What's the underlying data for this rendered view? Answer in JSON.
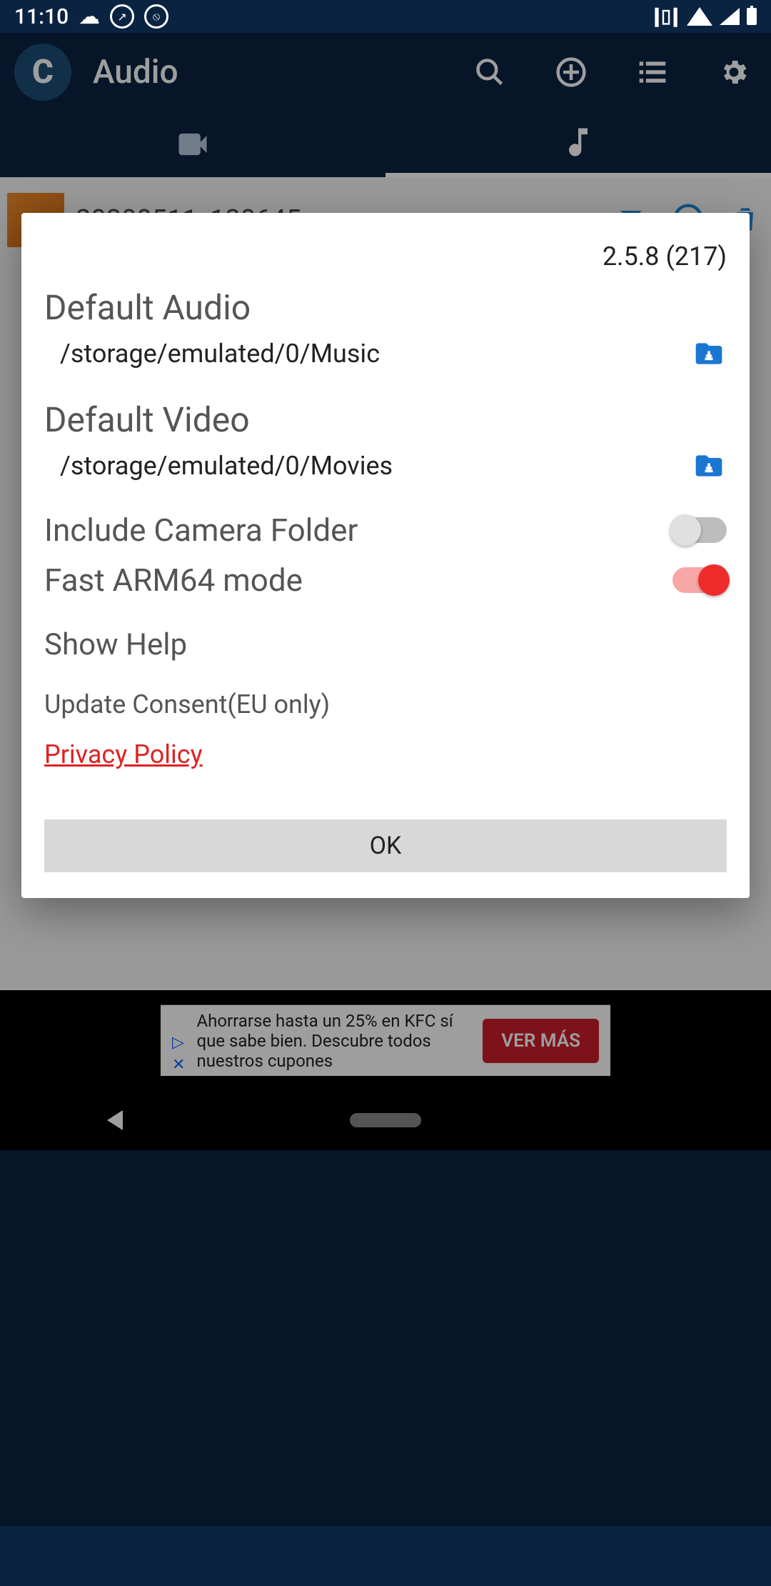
{
  "status": {
    "time": "11:10"
  },
  "appbar": {
    "title": "Audio"
  },
  "list": {
    "items": [
      {
        "name": "20200511_120645"
      }
    ]
  },
  "ad": {
    "text": "Ahorrarse hasta un 25% en KFC sí que sabe bien. Descubre todos nuestros cupones",
    "cta": "VER MÁS"
  },
  "dialog": {
    "version": "2.5.8 (217)",
    "audio_heading": "Default Audio",
    "audio_path": "/storage/emulated/0/Music",
    "video_heading": "Default Video",
    "video_path": "/storage/emulated/0/Movies",
    "include_camera_label": "Include Camera Folder",
    "include_camera_on": false,
    "fast_arm_label": "Fast ARM64 mode",
    "fast_arm_on": true,
    "show_help": "Show Help",
    "consent": "Update Consent(EU only)",
    "privacy": "Privacy Policy",
    "ok": "OK"
  }
}
